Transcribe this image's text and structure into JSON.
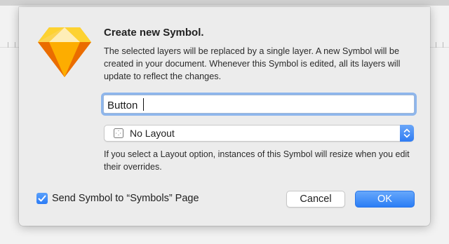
{
  "dialog": {
    "title": "Create new Symbol.",
    "message": "The selected layers will be replaced by a single layer. A new Symbol will be created in your document. Whenever this Symbol is edited, all its layers will update to reflect the changes.",
    "app_icon": "sketch-diamond-icon"
  },
  "name_field": {
    "value": "Button",
    "focused": true
  },
  "layout_select": {
    "selected": "No Layout",
    "icon": "layout-grid-icon"
  },
  "helper_text": "If you select a Layout option, instances of this Symbol will resize when you edit their overrides.",
  "send_to_page": {
    "checked": true,
    "label": "Send Symbol to “Symbols” Page"
  },
  "buttons": {
    "cancel": "Cancel",
    "ok": "OK"
  },
  "colors": {
    "accent": "#2f7df5",
    "focus_ring": "#8eb6ec",
    "dialog_bg": "#ececec",
    "icon_orange": "#f7a928",
    "icon_yellow": "#fdd231"
  }
}
